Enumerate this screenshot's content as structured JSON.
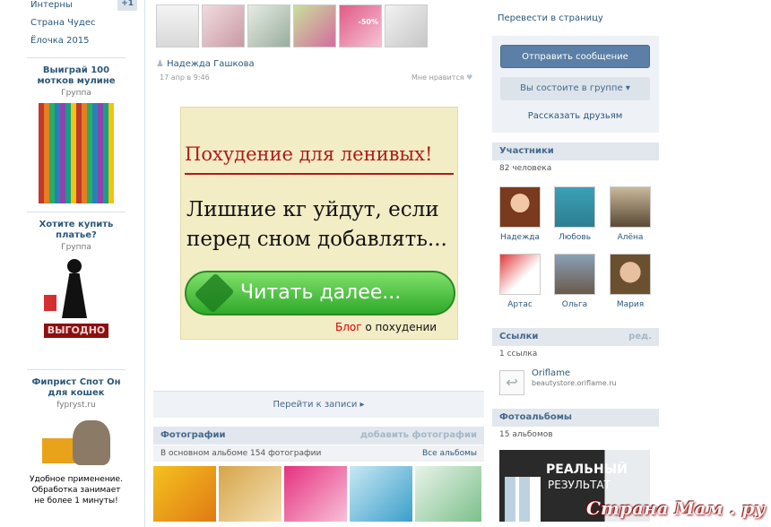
{
  "left_menu": {
    "items": [
      {
        "label": "Интерны",
        "count": "+1"
      },
      {
        "label": "Страна Чудес"
      },
      {
        "label": "Ёлочка 2015"
      }
    ]
  },
  "ads": [
    {
      "title": "Выиграй 100 мотков мулине",
      "subtitle": "Группа"
    },
    {
      "title": "Хотите купить платье?",
      "subtitle": "Группа",
      "badge": "ВЫГОДНО"
    },
    {
      "title": "Фиприст Спот Он для кошек",
      "subtitle": "fypryst.ru",
      "text": "Удобное применение. Обработка занимает не более 1 минуты!"
    }
  ],
  "post": {
    "author": "Надежда Гашкова",
    "date": "17 апр в 9:46",
    "like": "Мне нравится",
    "banner_title": "Похудение для ленивых!",
    "banner_text_1": "Лишние кг уйдут, если",
    "banner_text_2": "перед сном добавлять...",
    "banner_button": "Читать далее...",
    "banner_blog_red": "Блог",
    "banner_blog_rest": " о похудении",
    "thumb_badge": "-50%",
    "goto_label": "Перейти к записи ▸"
  },
  "photos": {
    "title": "Фотографии",
    "add_label": "добавить фотографии",
    "album_info": "В основном альбоме 154 фотографии",
    "all_albums": "Все альбомы"
  },
  "right": {
    "translate_link": "Перевести в страницу",
    "send_message": "Отправить сообщение",
    "in_group": "Вы состоите в группе",
    "tell_friends": "Рассказать друзьям",
    "members_title": "Участники",
    "members_count": "82 человека",
    "members": [
      "Надежда",
      "Любовь",
      "Алёна",
      "Артас",
      "Ольга",
      "Мария"
    ],
    "links_title": "Ссылки",
    "links_edit": "ред.",
    "links_count": "1 ссылка",
    "link_name": "Oriflame",
    "link_url": "beautystore.oriflame.ru",
    "albums_title": "Фотоальбомы",
    "albums_count": "15 альбомов",
    "album_cover_text_1": "РЕАЛЬНЫЙ",
    "album_cover_text_2": "РЕЗУЛЬТАТ"
  },
  "watermark": "Страна Мам . ру",
  "colors": {
    "link": "#2b587a",
    "button_blue": "#5b7fa6",
    "header_bg": "#e1e7ed"
  }
}
